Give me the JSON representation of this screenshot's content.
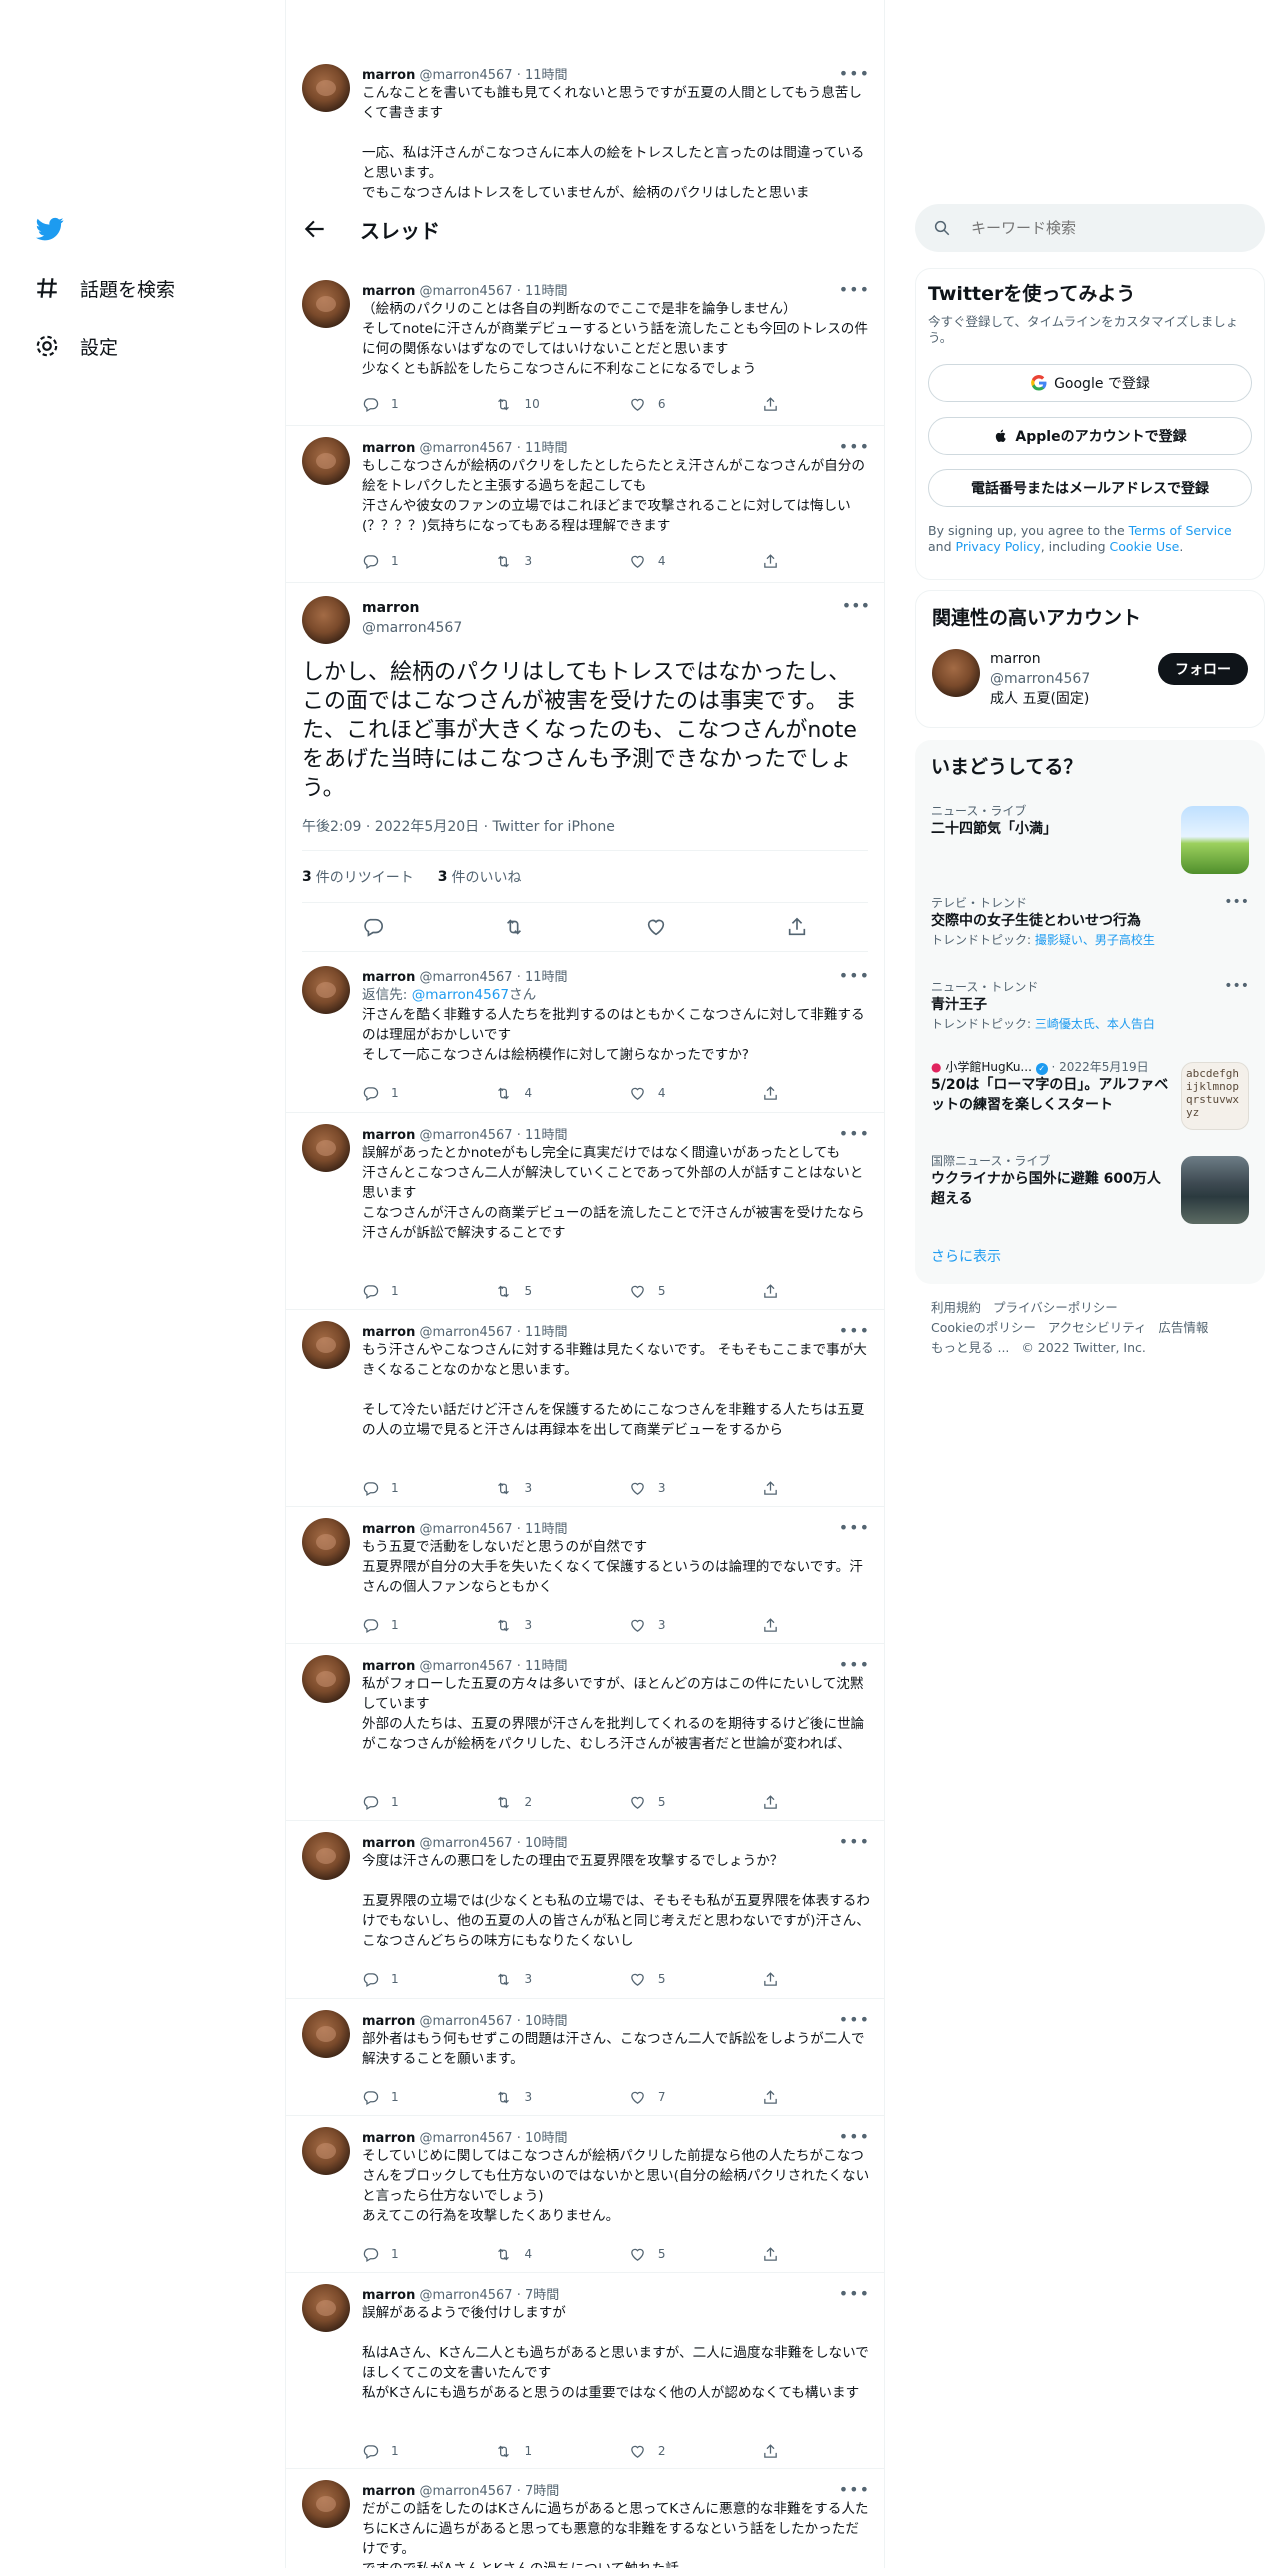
{
  "nav": {
    "explore": "話題を検索",
    "settings": "設定"
  },
  "header": {
    "title": "スレッド"
  },
  "top_tweet": {
    "name": "marron",
    "handle": "@marron4567",
    "time": "· 11時間",
    "text": "こんなことを書いても誰も見てくれないと思うですが五夏の人間としてもう息苦しくて書きます\n\n一応、私は汗さんがこなつさんに本人の絵をトレスしたと言ったのは間違っていると思います。\nでもこなつさんはトレスをしていませんが、絵柄のパクリはしたと思いま"
  },
  "tweets_above": [
    {
      "name": "marron",
      "handle": "@marron4567",
      "time": "· 11時間",
      "text": "（絵柄のパクリのことは各自の判断なのでここで是非を論争しません）\nそしてnoteに汗さんが商業デビューするという話を流したことも今回のトレスの件に何の関係ないはずなのでしてはいけないことだと思います\n少なくとも訴訟をしたらこなつさんに不利なことになるでしょう",
      "reply": "1",
      "retweet": "10",
      "like": "6"
    },
    {
      "name": "marron",
      "handle": "@marron4567",
      "time": "· 11時間",
      "text": "もしこなつさんが絵柄のパクリをしたとしたらたとえ汗さんがこなつさんが自分の絵をトレパクしたと主張する過ちを起こしても\n汗さんや彼女のファンの立場ではこれほどまで攻撃されることに対しては悔しい(？？？？)気持ちになってもある程は理解できます",
      "reply": "1",
      "retweet": "3",
      "like": "4"
    }
  ],
  "main_tweet": {
    "name": "marron",
    "handle": "@marron4567",
    "text": "しかし、絵柄のパクリはしてもトレスではなかったし、この面ではこなつさんが被害を受けたのは事実です。 また、これほど事が大きくなったのも、こなつさんがnoteをあげた当時にはこなつさんも予測できなかったでしょう。",
    "meta": "午後2:09 · 2022年5月20日 · Twitter for iPhone",
    "retweets_count": "3",
    "retweets_label": "件のリツイート",
    "likes_count": "3",
    "likes_label": "件のいいね"
  },
  "replies": [
    {
      "name": "marron",
      "handle": "@marron4567",
      "time": "· 11時間",
      "reply_to_prefix": "返信先: ",
      "reply_to_handle": "@marron4567",
      "reply_to_suffix": "さん",
      "text": "汗さんを酷く非難する人たちを批判するのはともかくこなつさんに対して非難するのは理屈がおかしいです\nそして一応こなつさんは絵柄模作に対して謝らなかったですか?",
      "reply": "1",
      "retweet": "4",
      "like": "4"
    },
    {
      "name": "marron",
      "handle": "@marron4567",
      "time": "· 11時間",
      "text": "誤解があったとかnoteがもし完全に真実だけではなく間違いがあったとしても\n汗さんとこなつさん二人が解決していくことであって外部の人が話すことはないと思います\nこなつさんが汗さんの商業デビューの話を流したことで汗さんが被害を受けたなら汗さんが訴訟で解決することです",
      "reply": "1",
      "retweet": "5",
      "like": "5"
    },
    {
      "name": "marron",
      "handle": "@marron4567",
      "time": "· 11時間",
      "text": "もう汗さんやこなつさんに対する非難は見たくないです。 そもそもここまで事が大きくなることなのかなと思います。\n\nそして冷たい話だけど汗さんを保護するためにこなつさんを非難する人たちは五夏の人の立場で見ると汗さんは再録本を出して商業デビューをするから",
      "reply": "1",
      "retweet": "3",
      "like": "3"
    },
    {
      "name": "marron",
      "handle": "@marron4567",
      "time": "· 11時間",
      "text": "もう五夏で活動をしないだと思うのが自然です\n五夏界隈が自分の大手を失いたくなくて保護するというのは論理的でないです。汗さんの個人ファンならともかく",
      "reply": "1",
      "retweet": "3",
      "like": "3"
    },
    {
      "name": "marron",
      "handle": "@marron4567",
      "time": "· 11時間",
      "text": "私がフォローした五夏の方々は多いですが、ほとんどの方はこの件にたいして沈黙しています\n外部の人たちは、五夏の界隈が汗さんを批判してくれるのを期待するけど後に世論がこなつさんが絵柄をパクリした、むしろ汗さんが被害者だと世論が変われば、",
      "reply": "1",
      "retweet": "2",
      "like": "5"
    },
    {
      "name": "marron",
      "handle": "@marron4567",
      "time": "· 10時間",
      "text": "今度は汗さんの悪口をしたの理由で五夏界隈を攻撃するでしょうか？\n\n五夏界隈の立場では(少なくとも私の立場では、そもそも私が五夏界隈を体表するわけでもないし、他の五夏の人の皆さんが私と同じ考えだと思わないですが)汗さん、こなつさんどちらの味方にもなりたくないし",
      "reply": "1",
      "retweet": "3",
      "like": "5"
    },
    {
      "name": "marron",
      "handle": "@marron4567",
      "time": "· 10時間",
      "text": "部外者はもう何もせずこの問題は汗さん、こなつさん二人で訴訟をしようが二人で解決することを願います。",
      "reply": "1",
      "retweet": "3",
      "like": "7"
    },
    {
      "name": "marron",
      "handle": "@marron4567",
      "time": "· 10時間",
      "text": "そしていじめに関してはこなつさんが絵柄パクリした前提なら他の人たちがこなつさんをブロックしても仕方ないのではないかと思い(自分の絵柄パクリされたくないと言ったら仕方ないでしょう)\nあえてこの行為を攻撃したくありません。",
      "reply": "1",
      "retweet": "4",
      "like": "5"
    },
    {
      "name": "marron",
      "handle": "@marron4567",
      "time": "· 7時間",
      "text": "誤解があるようで後付けしますが\n\n私はAさん、Kさん二人とも過ちがあると思いますが、二人に過度な非難をしないでほしくてこの文を書いたんです\n私がKさんにも過ちがあると思うのは重要ではなく他の人が認めなくても構います",
      "reply": "1",
      "retweet": "1",
      "like": "2"
    },
    {
      "name": "marron",
      "handle": "@marron4567",
      "time": "· 7時間",
      "text": "だがこの話をしたのはKさんに過ちがあると思ってKさんに悪意的な非難をする人たちにKさんに過ちがあると思っても悪意的な非難をするなという話をしたかっただけです。\nですので私がAさんとKさんの過ちについて触れた話",
      "reply": "",
      "retweet": "",
      "like": ""
    }
  ],
  "sidebar": {
    "search_placeholder": "キーワード検索",
    "signup": {
      "title": "Twitterを使ってみよう",
      "subtitle": "今すぐ登録して、タイムラインをカスタマイズしましょう。",
      "google": "Google で登録",
      "apple": "Appleのアカウントで登録",
      "phone": "電話番号またはメールアドレスで登録",
      "terms_1": "By signing up, you agree to the ",
      "terms_link": "Terms of Service",
      "terms_2": " and ",
      "privacy_link": "Privacy Policy",
      "terms_3": ", including ",
      "cookie_link": "Cookie Use",
      "terms_4": "."
    },
    "related": {
      "title": "関連性の高いアカウント",
      "name": "marron",
      "handle": "@marron4567",
      "bio": "成人 五夏(固定)",
      "follow": "フォロー"
    },
    "trends": {
      "title": "いまどうしてる？",
      "items": [
        {
          "cat": "ニュース・ライブ",
          "title": "二十四節気「小満」"
        },
        {
          "cat": "テレビ・トレンド",
          "title": "交際中の女子生徒とわいせつ行為",
          "sub_prefix": "トレンドトピック: ",
          "sub_links": "撮影疑い、男子高校生"
        },
        {
          "cat": "ニュース・トレンド",
          "title": "青汁王子",
          "sub_prefix": "トレンドトピック: ",
          "sub_links": "三崎優太氏、本人告白"
        },
        {
          "cat": "小学館HugKu...",
          "cat_date": "· 2022年5月19日",
          "title": "5/20は「ローマ字の日」。アルファベットの練習を楽しくスタート"
        },
        {
          "cat": "国際ニュース・ライブ",
          "title": "ウクライナから国外に避難 600万人超える"
        }
      ],
      "more": "さらに表示"
    },
    "footer": {
      "line1": [
        "利用規約",
        "プライバシーポリシー"
      ],
      "line2": [
        "Cookieのポリシー",
        "アクセシビリティ",
        "広告情報"
      ],
      "line3_more": "もっと見る ...",
      "copyright": "© 2022 Twitter, Inc."
    }
  },
  "colors": {
    "accent": "#1d9bf0",
    "text": "#0f1419",
    "muted": "#536471",
    "border": "#eff3f4"
  }
}
